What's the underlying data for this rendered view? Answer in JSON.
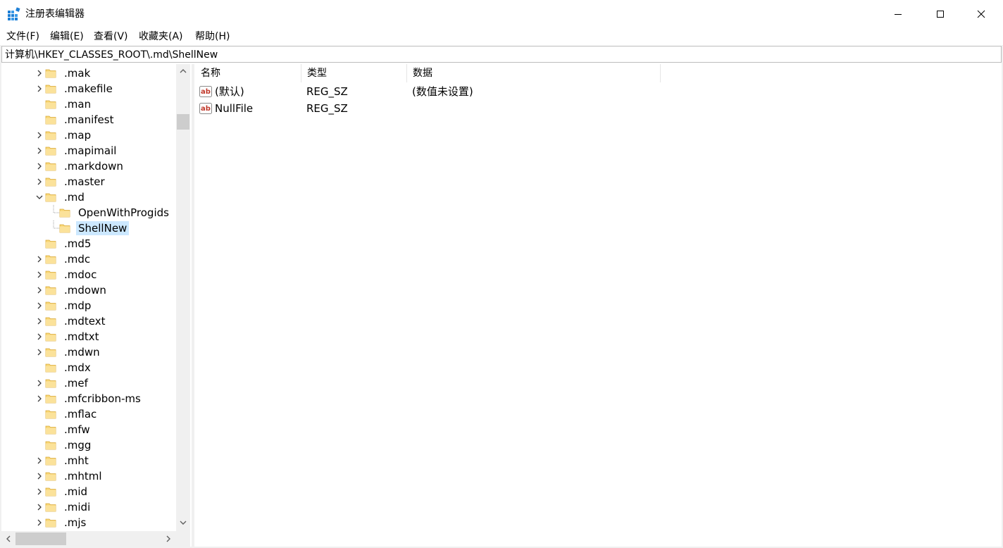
{
  "window": {
    "title": "注册表编辑器",
    "controls": [
      "minimize-icon",
      "maximize-icon",
      "close-icon"
    ]
  },
  "menu": [
    {
      "label": "文件(F)"
    },
    {
      "label": "编辑(E)"
    },
    {
      "label": "查看(V)"
    },
    {
      "label": "收藏夹(A)"
    },
    {
      "label": "帮助(H)"
    }
  ],
  "address": {
    "path": "计算机\\HKEY_CLASSES_ROOT\\.md\\ShellNew"
  },
  "tree": {
    "items": [
      {
        "label": ".mak",
        "expandable": true
      },
      {
        "label": ".makefile",
        "expandable": true
      },
      {
        "label": ".man",
        "expandable": false
      },
      {
        "label": ".manifest",
        "expandable": false
      },
      {
        "label": ".map",
        "expandable": true
      },
      {
        "label": ".mapimail",
        "expandable": true
      },
      {
        "label": ".markdown",
        "expandable": true
      },
      {
        "label": ".master",
        "expandable": true
      },
      {
        "label": ".md",
        "expandable": true,
        "expanded": true
      },
      {
        "label": "OpenWithProgids",
        "child": true
      },
      {
        "label": "ShellNew",
        "child": true,
        "selected": true
      },
      {
        "label": ".md5",
        "expandable": false
      },
      {
        "label": ".mdc",
        "expandable": true
      },
      {
        "label": ".mdoc",
        "expandable": true
      },
      {
        "label": ".mdown",
        "expandable": true
      },
      {
        "label": ".mdp",
        "expandable": true
      },
      {
        "label": ".mdtext",
        "expandable": true
      },
      {
        "label": ".mdtxt",
        "expandable": true
      },
      {
        "label": ".mdwn",
        "expandable": true
      },
      {
        "label": ".mdx",
        "expandable": false
      },
      {
        "label": ".mef",
        "expandable": true
      },
      {
        "label": ".mfcribbon-ms",
        "expandable": true
      },
      {
        "label": ".mflac",
        "expandable": false
      },
      {
        "label": ".mfw",
        "expandable": false
      },
      {
        "label": ".mgg",
        "expandable": false
      },
      {
        "label": ".mht",
        "expandable": true
      },
      {
        "label": ".mhtml",
        "expandable": true
      },
      {
        "label": ".mid",
        "expandable": true
      },
      {
        "label": ".midi",
        "expandable": true
      },
      {
        "label": ".mjs",
        "expandable": true
      }
    ]
  },
  "list": {
    "columns": [
      "名称",
      "类型",
      "数据"
    ],
    "rows": [
      {
        "name": "(默认)",
        "type": "REG_SZ",
        "data": "(数值未设置)"
      },
      {
        "name": "NullFile",
        "type": "REG_SZ",
        "data": ""
      }
    ]
  },
  "colors": {
    "selection": "#cce8ff",
    "folder": "#f8d775",
    "scroll_track": "#f0f0f0",
    "scroll_thumb": "#cdcdcd"
  }
}
